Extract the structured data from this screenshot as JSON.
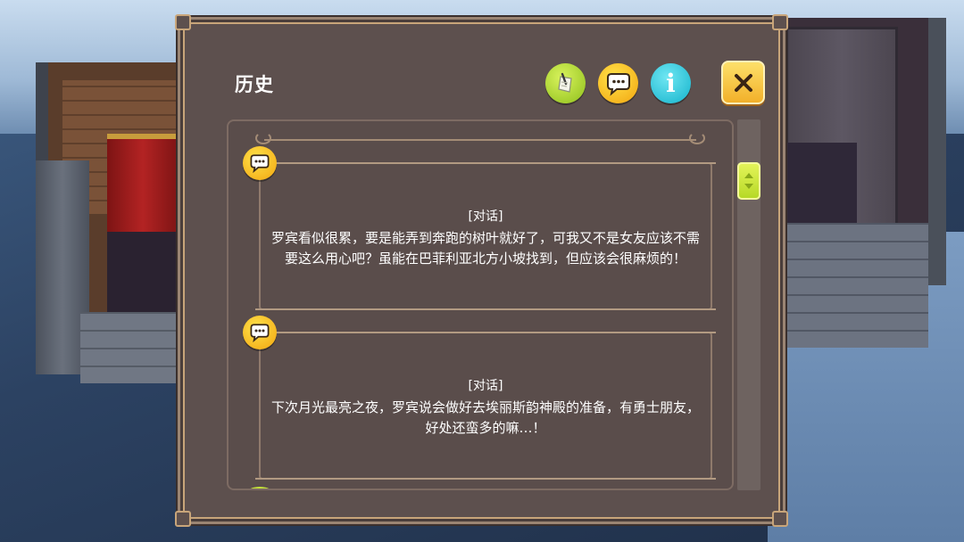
{
  "window": {
    "title": "历史"
  },
  "toolbar": {
    "quest_icon": "quest-scroll-icon",
    "chat_icon": "chat-bubble-icon",
    "info_icon": "info-icon",
    "info_glyph": "i",
    "close_icon": "close-icon"
  },
  "entries": [
    {
      "icon": "chat-bubble-icon",
      "tag": "[对话]",
      "text": "罗宾看似很累，要是能弄到奔跑的树叶就好了，可我又不是女友应该不需要这么用心吧？虽能在巴菲利亚北方小坡找到，但应该会很麻烦的！"
    },
    {
      "icon": "chat-bubble-icon",
      "tag": "[对话]",
      "text": "下次月光最亮之夜，罗宾说会做好去埃丽斯韵神殿的准备，有勇士朋友，好处还蛮多的嘛…！"
    }
  ],
  "colors": {
    "panel_bg": "#5d504e",
    "panel_border": "#c8a57a",
    "quest_green": "#a8d52c",
    "chat_yellow": "#fbc22a",
    "info_cyan": "#2ec7dc",
    "close_yellow": "#f7c744",
    "scroll_thumb": "#c8e43a"
  }
}
